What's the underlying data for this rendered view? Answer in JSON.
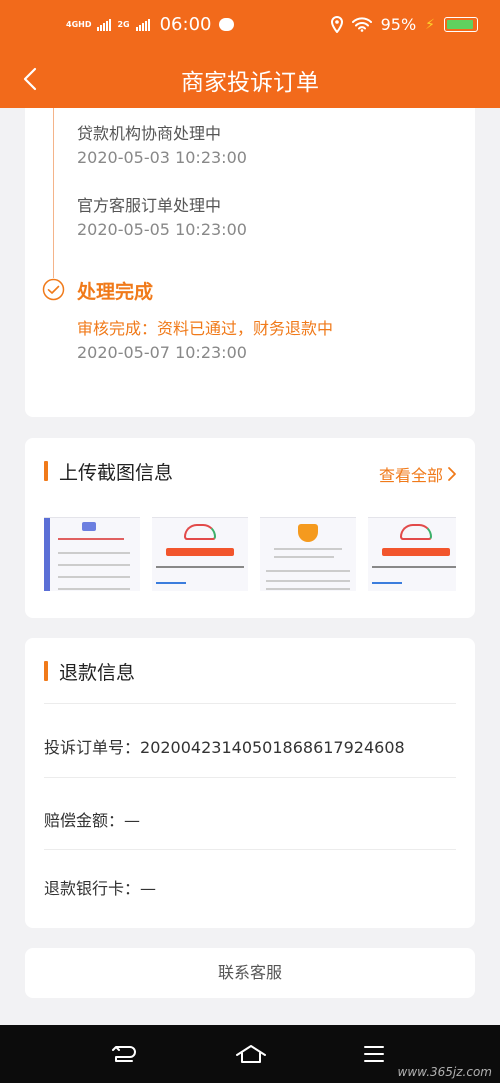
{
  "status_bar": {
    "network_1": "4GHD",
    "network_2": "2G",
    "time": "06:00",
    "battery_pct": "95%",
    "battery_level": 0.95
  },
  "header": {
    "title": "商家投诉订单"
  },
  "timeline": {
    "steps": [
      {
        "title": "贷款机构协商处理中",
        "time": "2020-05-03 10:23:00"
      },
      {
        "title": "官方客服订单处理中",
        "time": "2020-05-05 10:23:00"
      }
    ],
    "final": {
      "title": "处理完成",
      "detail": "审核完成：资料已通过，财务退款中",
      "time": "2020-05-07 10:23:00"
    }
  },
  "screenshots": {
    "title": "上传截图信息",
    "view_all": "查看全部"
  },
  "refund": {
    "title": "退款信息",
    "rows": [
      {
        "label": "投诉订单号：",
        "value": "20200423140501868617924608"
      },
      {
        "label": "赔偿金额：",
        "value": "—"
      },
      {
        "label": "退款银行卡：",
        "value": "—"
      }
    ]
  },
  "contact": {
    "label": "联系客服"
  },
  "watermark": "www.365jz.com",
  "colors": {
    "accent": "#f26a1b",
    "background": "#f2f2f4"
  }
}
